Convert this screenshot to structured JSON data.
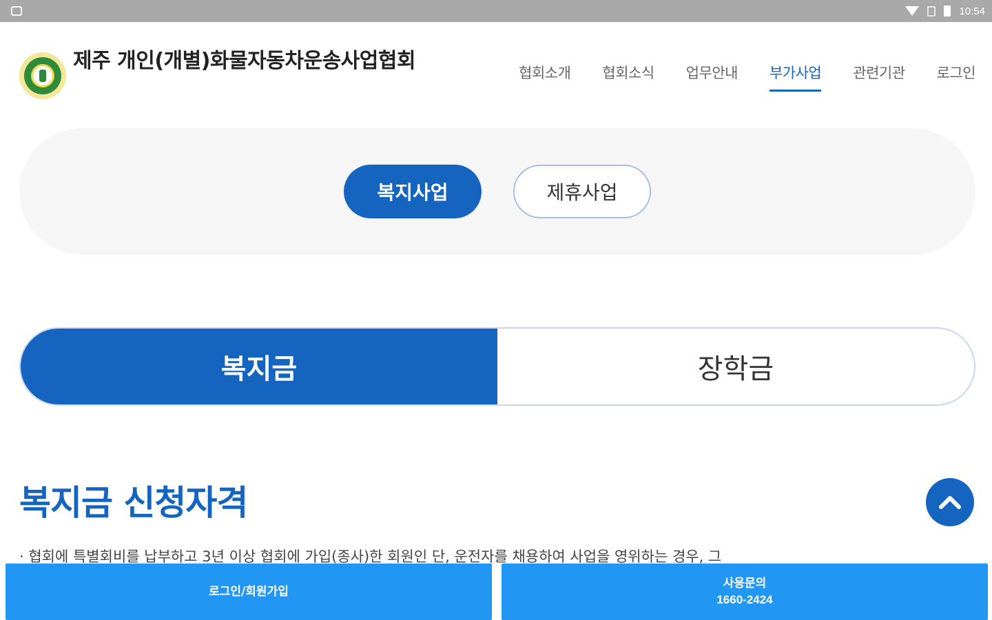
{
  "statusbar": {
    "time": "10:54",
    "icons": [
      "notification-icon",
      "wifi-icon",
      "sim-icon",
      "battery-icon"
    ]
  },
  "header": {
    "title": "제주 개인(개별)화물자동차운송사업협회",
    "nav": [
      {
        "label": "협회소개",
        "active": false
      },
      {
        "label": "협회소식",
        "active": false
      },
      {
        "label": "업무안내",
        "active": false
      },
      {
        "label": "부가사업",
        "active": true
      },
      {
        "label": "관련기관",
        "active": false
      },
      {
        "label": "로그인",
        "active": false
      }
    ]
  },
  "subnav": {
    "items": [
      {
        "label": "복지사업",
        "active": true
      },
      {
        "label": "제휴사업",
        "active": false
      }
    ]
  },
  "tabs": {
    "items": [
      {
        "label": "복지금",
        "active": true
      },
      {
        "label": "장학금",
        "active": false
      }
    ]
  },
  "section": {
    "title": "복지금 신청자격",
    "body": "· 협회에 특별회비를 납부하고 3년 이상 협회에 가입(종사)한 회원인 단, 운전자를 채용하여 사업을 영위하는 경우, 그"
  },
  "bottom_bar": {
    "login_label": "로그인/회원가입",
    "inquiry_label": "사용문의",
    "inquiry_phone": "1660-2424"
  },
  "colors": {
    "primary": "#1565c0",
    "bottom_button": "#2196f3",
    "statusbar": "#a9a9a9"
  }
}
